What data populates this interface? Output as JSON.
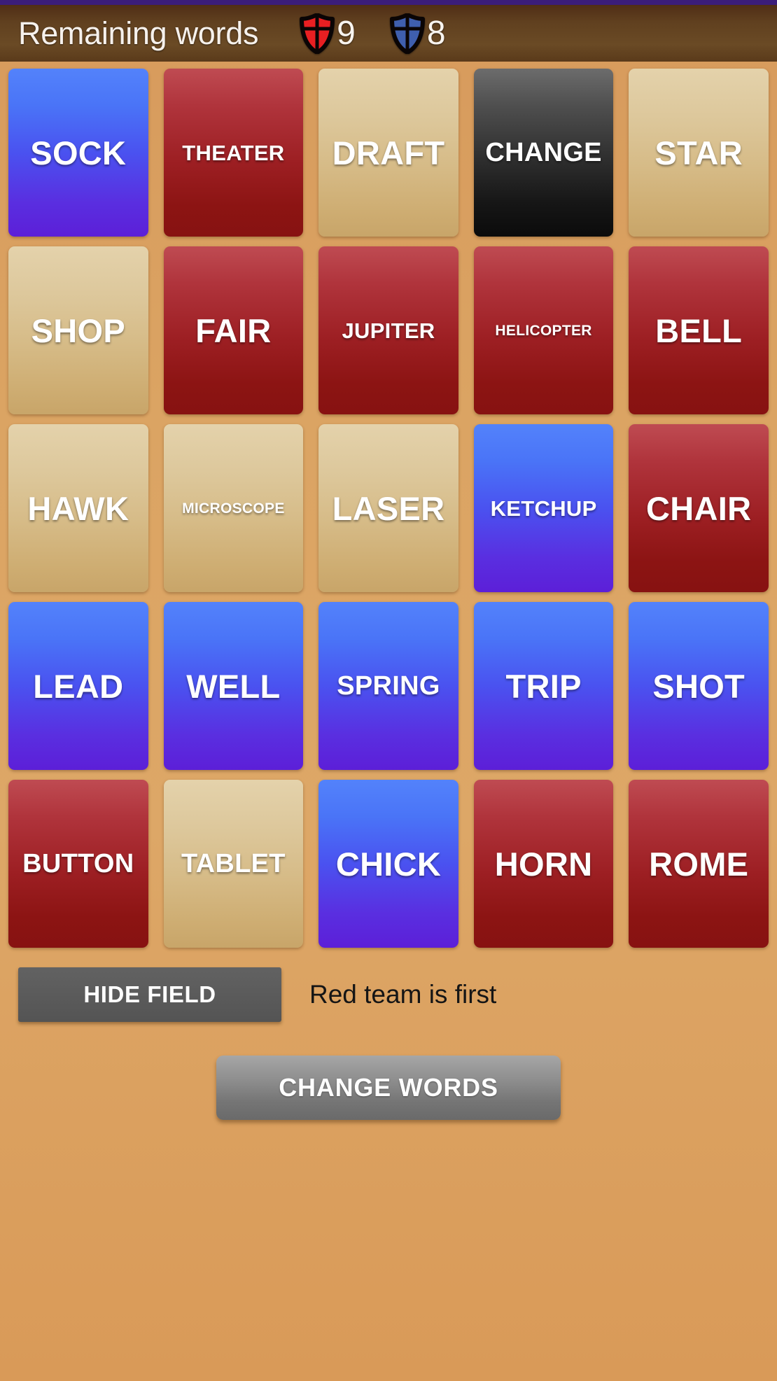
{
  "header": {
    "title": "Remaining words",
    "red_shield_icon": "shield-icon-red",
    "red_count": "9",
    "blue_shield_icon": "shield-icon-blue",
    "blue_count": "8"
  },
  "colors": {
    "background": "#dba463",
    "header_bar": "#60401f",
    "top_strip": "#3b1d7a",
    "red_team": "#9d1f23",
    "blue_team": "#4a74f7",
    "neutral": "#ddc89c",
    "assassin": "#161616",
    "button_gray": "#5b5b5b"
  },
  "board": {
    "rows": 5,
    "columns": 5,
    "cards": [
      {
        "word": "SOCK",
        "team": "blue"
      },
      {
        "word": "THEATER",
        "team": "red"
      },
      {
        "word": "DRAFT",
        "team": "neutral"
      },
      {
        "word": "CHANGE",
        "team": "assassin"
      },
      {
        "word": "STAR",
        "team": "neutral"
      },
      {
        "word": "SHOP",
        "team": "neutral"
      },
      {
        "word": "FAIR",
        "team": "red"
      },
      {
        "word": "JUPITER",
        "team": "red"
      },
      {
        "word": "HELICOPTER",
        "team": "red"
      },
      {
        "word": "BELL",
        "team": "red"
      },
      {
        "word": "HAWK",
        "team": "neutral"
      },
      {
        "word": "MICROSCOPE",
        "team": "neutral"
      },
      {
        "word": "LASER",
        "team": "neutral"
      },
      {
        "word": "KETCHUP",
        "team": "blue"
      },
      {
        "word": "CHAIR",
        "team": "red"
      },
      {
        "word": "LEAD",
        "team": "blue"
      },
      {
        "word": "WELL",
        "team": "blue"
      },
      {
        "word": "SPRING",
        "team": "blue"
      },
      {
        "word": "TRIP",
        "team": "blue"
      },
      {
        "word": "SHOT",
        "team": "blue"
      },
      {
        "word": "BUTTON",
        "team": "red"
      },
      {
        "word": "TABLET",
        "team": "neutral"
      },
      {
        "word": "CHICK",
        "team": "blue"
      },
      {
        "word": "HORN",
        "team": "red"
      },
      {
        "word": "ROME",
        "team": "red"
      }
    ]
  },
  "controls": {
    "hide_field_label": "HIDE FIELD",
    "turn_status": "Red team is first",
    "change_words_label": "CHANGE WORDS"
  }
}
